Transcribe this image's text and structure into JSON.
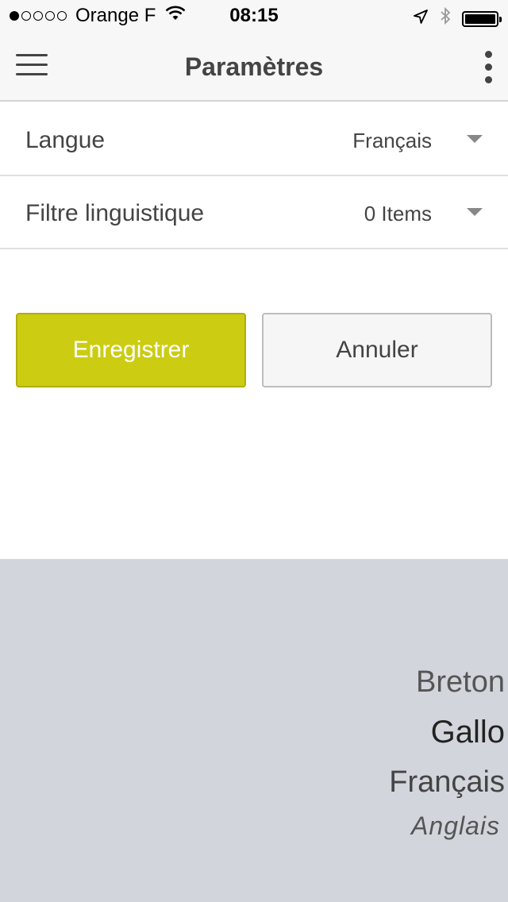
{
  "status_bar": {
    "carrier": "Orange F",
    "time": "08:15"
  },
  "header": {
    "title": "Paramètres"
  },
  "settings": [
    {
      "label": "Langue",
      "value": "Français"
    },
    {
      "label": "Filtre linguistique",
      "value": "0 Items"
    }
  ],
  "actions": {
    "save_label": "Enregistrer",
    "cancel_label": "Annuler"
  },
  "picker": {
    "options": [
      "Breton",
      "Gallo",
      "Français",
      "Anglais"
    ]
  },
  "colors": {
    "accent": "#cccc12",
    "picker_background": "#d2d5db"
  },
  "icons": {
    "menu": "hamburger-menu-icon",
    "more": "vertical-dots-icon",
    "dropdown": "caret-down-icon",
    "wifi": "wifi-icon",
    "location": "location-arrow-icon",
    "bluetooth": "bluetooth-icon",
    "battery": "battery-icon"
  }
}
